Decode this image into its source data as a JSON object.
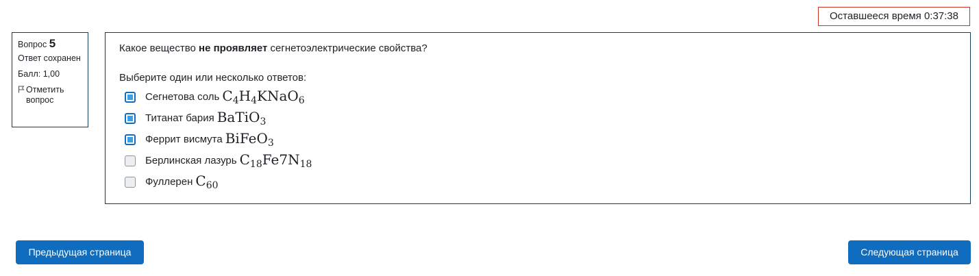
{
  "timer": {
    "label": "Оставшееся время 0:37:38"
  },
  "info": {
    "question_label": "Вопрос",
    "question_number": "5",
    "state": "Ответ сохранен",
    "grade": "Балл: 1,00",
    "flag_label": "Отметить вопрос"
  },
  "question": {
    "text_before": "Какое вещество",
    "text_bold": "не проявляет",
    "text_after": "сегнетоэлектрические свойства?",
    "prompt": "Выберите один или несколько ответов:",
    "answers": [
      {
        "name": "Сегнетова соль",
        "checked": true,
        "formula": [
          {
            "t": "C"
          },
          {
            "s": "4"
          },
          {
            "t": "H"
          },
          {
            "s": "4"
          },
          {
            "t": "KNaO"
          },
          {
            "s": "6"
          }
        ]
      },
      {
        "name": "Титанат бария",
        "checked": true,
        "formula": [
          {
            "t": "BaTiO"
          },
          {
            "s": "3"
          }
        ]
      },
      {
        "name": "Феррит висмута",
        "checked": true,
        "formula": [
          {
            "t": "BiFeO"
          },
          {
            "s": "3"
          }
        ]
      },
      {
        "name": "Берлинская лазурь",
        "checked": false,
        "formula": [
          {
            "t": "C"
          },
          {
            "s": "18"
          },
          {
            "t": "Fe7N"
          },
          {
            "s": "18"
          }
        ]
      },
      {
        "name": "Фуллерен",
        "checked": false,
        "formula": [
          {
            "t": "C"
          },
          {
            "s": "60"
          }
        ]
      }
    ]
  },
  "nav": {
    "prev_label": "Предыдущая страница",
    "next_label": "Следующая страница"
  }
}
